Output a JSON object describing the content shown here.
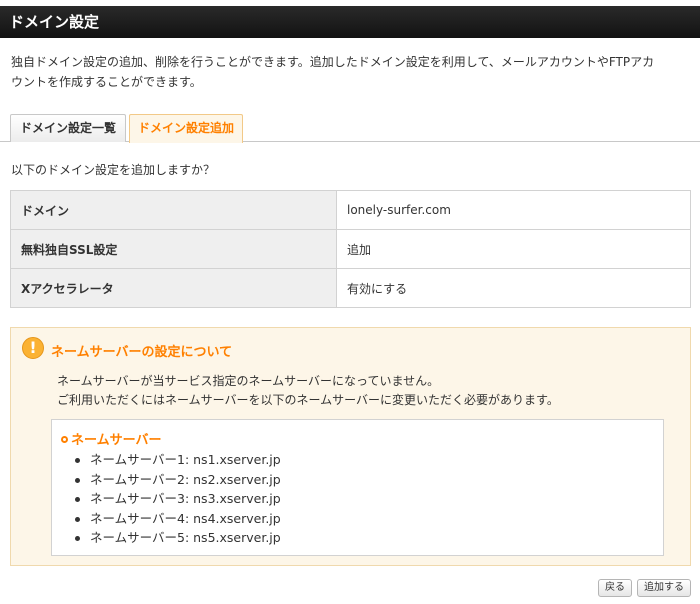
{
  "header": {
    "title": "ドメイン設定"
  },
  "intro": {
    "line1": "独自ドメイン設定の追加、削除を行うことができます。追加したドメイン設定を利用して、メールアカウントやFTPアカ",
    "line2": "ウントを作成することができます。"
  },
  "tabs": [
    {
      "label": "ドメイン設定一覧",
      "active": false
    },
    {
      "label": "ドメイン設定追加",
      "active": true
    }
  ],
  "question": "以下のドメイン設定を追加しますか？",
  "summary": {
    "rows": [
      {
        "label": "ドメイン",
        "value": "lonely-surfer.com"
      },
      {
        "label": "無料独自SSL設定",
        "value": "追加"
      },
      {
        "label": "Xアクセラレータ",
        "value": "有効にする"
      }
    ]
  },
  "notice": {
    "icon": "exclamation-icon",
    "title": "ネームサーバーの設定について",
    "message_line1": "ネームサーバーが当サービス指定のネームサーバーになっていません。",
    "message_line2": "ご利用いただくにはネームサーバーを以下のネームサーバーに変更いただく必要があります。",
    "ns_title": "ネームサーバー",
    "nameservers": [
      "ネームサーバー1: ns1.xserver.jp",
      "ネームサーバー2: ns2.xserver.jp",
      "ネームサーバー3: ns3.xserver.jp",
      "ネームサーバー4: ns4.xserver.jp",
      "ネームサーバー5: ns5.xserver.jp"
    ]
  },
  "buttons": {
    "back": "戻る",
    "add": "追加する"
  },
  "colors": {
    "accent": "#ff8000",
    "header": "#1a1a1a",
    "notice_bg": "#fdf6e8"
  }
}
